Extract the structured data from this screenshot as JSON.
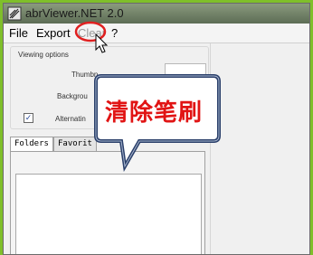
{
  "window": {
    "title": "abrViewer.NET 2.0"
  },
  "menu": {
    "items": [
      {
        "label": "File",
        "enabled": true
      },
      {
        "label": "Export",
        "enabled": true
      },
      {
        "label": "Clear",
        "enabled": false
      },
      {
        "label": "?",
        "enabled": true
      }
    ]
  },
  "options": {
    "group_title": "Viewing options",
    "thumbnail_label": "Thumbn",
    "background_label": "Backgrou",
    "alternating_label": "Alternatin",
    "alternating_checked": true
  },
  "tabs": [
    {
      "label": "Folders",
      "active": true
    },
    {
      "label": "Favorit",
      "active": false
    }
  ],
  "annotation": {
    "text": "清除笔刷",
    "bubble_color": "#ffffff",
    "text_color": "#e11414",
    "circle_color": "#e02020"
  }
}
